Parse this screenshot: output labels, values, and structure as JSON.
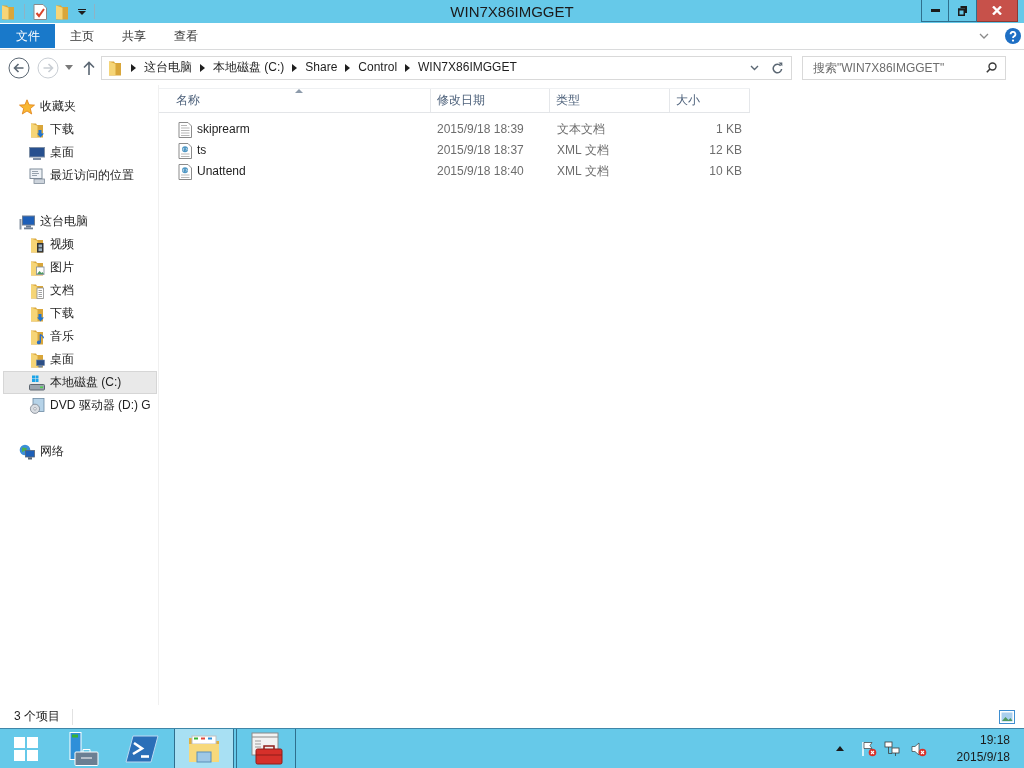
{
  "window": {
    "title": "WIN7X86IMGGET"
  },
  "ribbon": {
    "tabs": [
      {
        "label": "文件",
        "kind": "file"
      },
      {
        "label": "主页",
        "kind": "tab"
      },
      {
        "label": "共享",
        "kind": "tab"
      },
      {
        "label": "查看",
        "kind": "tab"
      }
    ]
  },
  "navigation": {
    "buttons": [
      {
        "kind": "back",
        "disabled": false
      },
      {
        "kind": "forward",
        "disabled": true
      }
    ]
  },
  "address_bar": {
    "crumbs": [
      "这台电脑",
      "本地磁盘 (C:)",
      "Share",
      "Control",
      "WIN7X86IMGGET"
    ]
  },
  "search": {
    "placeholder": "搜索\"WIN7X86IMGGET\""
  },
  "sidebar": {
    "items": [
      {
        "label": "收藏夹",
        "kind": "favorites",
        "selected": false,
        "children": [
          {
            "label": "下载",
            "kind": "downloads",
            "selected": false
          },
          {
            "label": "桌面",
            "kind": "desktop",
            "selected": false
          },
          {
            "label": "最近访问的位置",
            "kind": "recent",
            "selected": false
          }
        ]
      },
      {
        "label": "这台电脑",
        "kind": "computer",
        "selected": false,
        "children": [
          {
            "label": "视频",
            "kind": "videos",
            "selected": false
          },
          {
            "label": "图片",
            "kind": "pictures",
            "selected": false
          },
          {
            "label": "文档",
            "kind": "documents",
            "selected": false
          },
          {
            "label": "下载",
            "kind": "downloads",
            "selected": false
          },
          {
            "label": "音乐",
            "kind": "music",
            "selected": false
          },
          {
            "label": "桌面",
            "kind": "desktop-folder",
            "selected": false
          },
          {
            "label": "本地磁盘 (C:)",
            "kind": "drive",
            "selected": true
          },
          {
            "label": "DVD 驱动器 (D:) G",
            "kind": "dvd",
            "selected": false
          }
        ]
      },
      {
        "label": "网络",
        "kind": "network",
        "selected": false
      }
    ]
  },
  "file_list": {
    "columns": [
      {
        "label": "名称",
        "sorted": true
      },
      {
        "label": "修改日期",
        "sorted": false
      },
      {
        "label": "类型",
        "sorted": false
      },
      {
        "label": "大小",
        "sorted": false
      }
    ],
    "rows": [
      {
        "kind": "text",
        "name": "skiprearm",
        "modified": "2015/9/18 18:39",
        "type": "文本文档",
        "size": "1 KB",
        "selected": false
      },
      {
        "kind": "xml",
        "name": "ts",
        "modified": "2015/9/18 18:37",
        "type": "XML 文档",
        "size": "12 KB",
        "selected": false
      },
      {
        "kind": "xml",
        "name": "Unattend",
        "modified": "2015/9/18 18:40",
        "type": "XML 文档",
        "size": "10 KB",
        "selected": false
      }
    ]
  },
  "status_bar": {
    "item_count": "3 个项目"
  },
  "taskbar": {
    "buttons": [
      {
        "kind": "start",
        "running": false,
        "selected": false
      },
      {
        "kind": "server-manager",
        "running": false,
        "selected": false
      },
      {
        "kind": "powershell",
        "running": false,
        "selected": false
      },
      {
        "kind": "explorer",
        "running": true,
        "selected": true
      },
      {
        "kind": "toolbox",
        "running": true,
        "selected": false
      }
    ],
    "clock": {
      "time": "19:18",
      "date": "2015/9/18"
    }
  }
}
